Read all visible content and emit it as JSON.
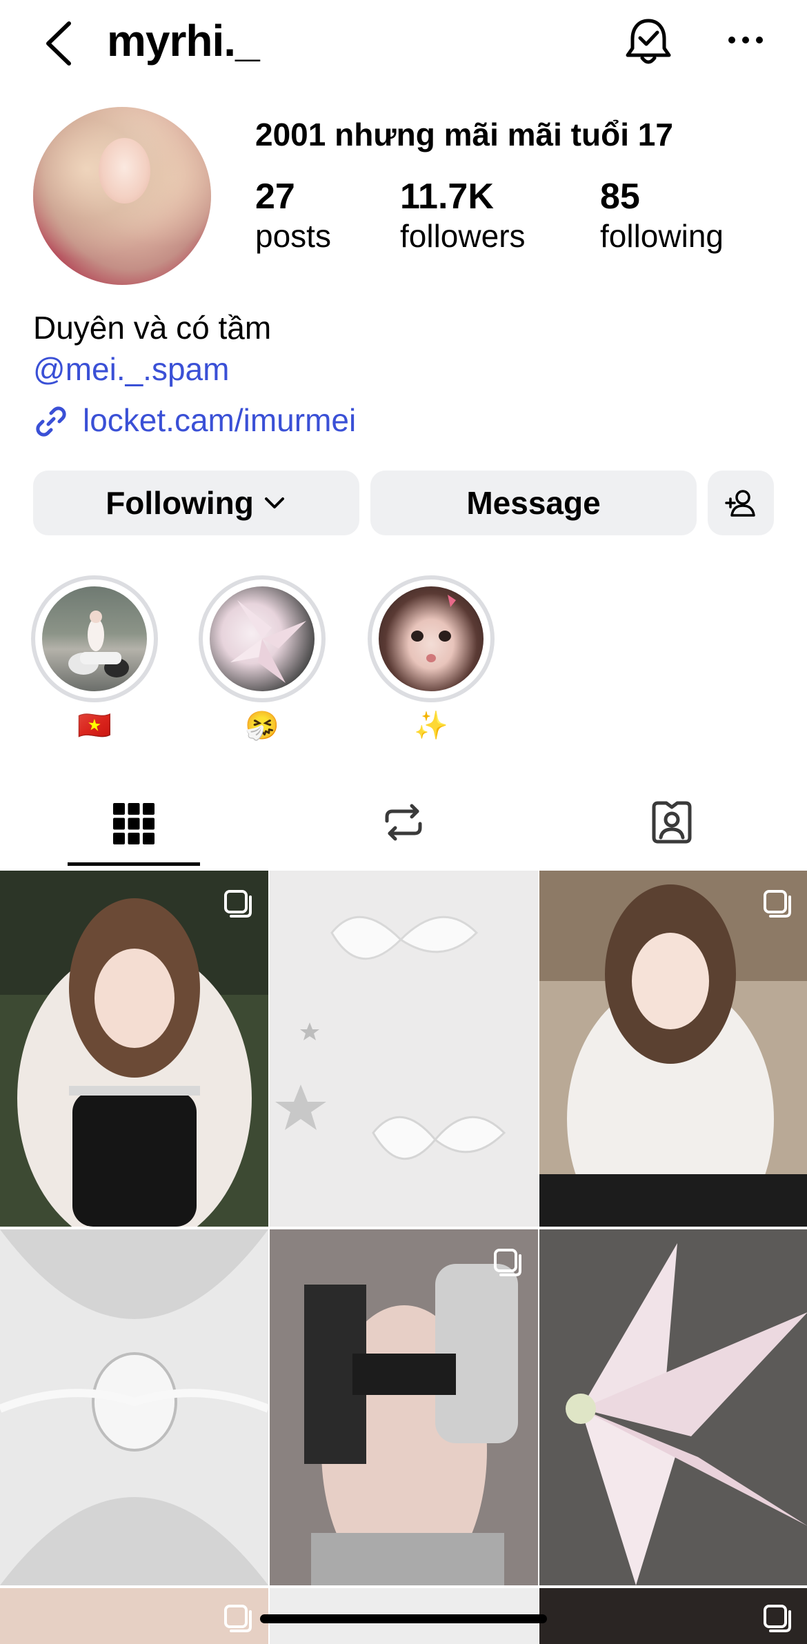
{
  "header": {
    "username": "myrhi._"
  },
  "profile": {
    "display_name": "2001 nhưng mãi mãi tuổi 17",
    "stats": [
      {
        "value": "27",
        "label": "posts"
      },
      {
        "value": "11.7K",
        "label": "followers"
      },
      {
        "value": "85",
        "label": "following"
      }
    ],
    "bio": "Duyên và có tầm",
    "mention": "@mei._.spam",
    "link": "locket.cam/imurmei"
  },
  "actions": {
    "following_label": "Following",
    "message_label": "Message"
  },
  "highlights": [
    {
      "label": "🇻🇳"
    },
    {
      "label": "🤧"
    },
    {
      "label": "✨"
    }
  ],
  "tabs": [
    {
      "icon": "grid-icon",
      "active": true
    },
    {
      "icon": "reposts-icon",
      "active": false
    },
    {
      "icon": "tagged-icon",
      "active": false
    }
  ],
  "colors": {
    "link_blue": "#3a50d6",
    "button_bg": "#eff0f2"
  }
}
